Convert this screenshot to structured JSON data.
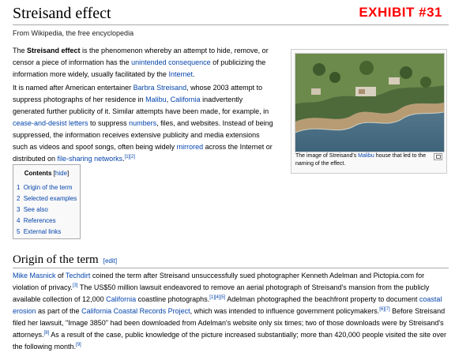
{
  "page": {
    "title": "Streisand effect",
    "exhibit_label": "EXHIBIT #31",
    "tagline": "From Wikipedia, the free encyclopedia"
  },
  "intro": {
    "p1": {
      "a": "The ",
      "bold": "Streisand effect",
      "b": " is the phenomenon whereby an attempt to hide, remove, or censor a piece of information has the ",
      "link1": "unintended consequence",
      "c": " of publicizing the information more widely, usually facilitated by the ",
      "link2": "Internet",
      "d": "."
    },
    "p2": {
      "a": "It is named after American entertainer ",
      "link_streisand": "Barbra Streisand",
      "b": ", whose 2003 attempt to suppress photographs of her residence in ",
      "link_malibu": "Malibu",
      "comma": ", ",
      "link_california": "California",
      "c": " inadvertently generated further publicity of it. Similar attempts have been made, for example, in ",
      "link_cease": "cease-and-desist letters",
      "d": " to suppress ",
      "link_numbers": "numbers",
      "e": ", files, and websites. Instead of being suppressed, the information receives extensive publicity and media extensions such as videos and spoof songs, often being widely ",
      "link_mirrored": "mirrored",
      "f": " across the Internet or distributed on ",
      "link_fileshare": "file-sharing networks",
      "g": ".",
      "ref1": "[1]",
      "ref2": "[2]"
    }
  },
  "thumbnail": {
    "caption_a": "The image of Streisand's ",
    "caption_link": "Malibu",
    "caption_b": " house that led to the naming of the effect.",
    "icon": "magnify-clip-icon"
  },
  "toc": {
    "title": "Contents",
    "toggle_open": "[",
    "toggle": "hide",
    "toggle_close": "]",
    "items": [
      {
        "num": "1",
        "label": "Origin of the term"
      },
      {
        "num": "2",
        "label": "Selected examples"
      },
      {
        "num": "3",
        "label": "See also"
      },
      {
        "num": "4",
        "label": "References"
      },
      {
        "num": "5",
        "label": "External links"
      }
    ]
  },
  "section": {
    "heading": "Origin of the term",
    "edit": "[edit]",
    "p": {
      "link_masnick": "Mike Masnick",
      "a": " of ",
      "link_techdirt": "Techdirt",
      "b": " coined the term after Streisand unsuccessfully sued photographer Kenneth Adelman and Pictopia.com for violation of privacy.",
      "ref3": "[3]",
      "c": " The US$50 million lawsuit endeavored to remove an aerial photograph of Streisand's mansion from the publicly available collection of 12,000 ",
      "link_california": "California",
      "d": " coastline photographs.",
      "ref1": "[1]",
      "ref4": "[4]",
      "ref5": "[5]",
      "e": " Adelman photographed the beachfront property to document ",
      "link_erosion": "coastal erosion",
      "f": " as part of the ",
      "link_ccrp": "California Coastal Records Project",
      "g": ", which was intended to influence government policymakers.",
      "ref6": "[6]",
      "ref7": "[7]",
      "h": " Before Streisand filed her lawsuit, \"Image 3850\" had been downloaded from Adelman's website only six times; two of those downloads were by Streisand's attorneys.",
      "ref8": "[8]",
      "i": " As a result of the case, public knowledge of the picture increased substantially; more than 420,000 people visited the site over the following month.",
      "ref9": "[9]"
    }
  }
}
